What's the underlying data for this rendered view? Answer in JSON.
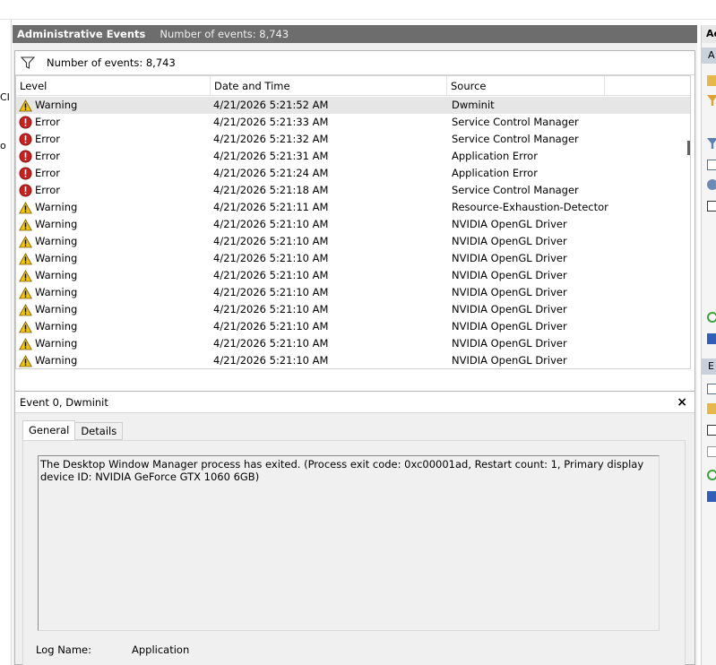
{
  "header": {
    "title": "Administrative Events",
    "count_label": "Number of events: 8,743"
  },
  "filter_bar": {
    "count_label": "Number of events: 8,743"
  },
  "columns": {
    "level": "Level",
    "datetime": "Date and Time",
    "source": "Source"
  },
  "events": [
    {
      "level": "Warning",
      "datetime": "4/21/2026 5:21:52 AM",
      "source": "Dwminit"
    },
    {
      "level": "Error",
      "datetime": "4/21/2026 5:21:33 AM",
      "source": "Service Control Manager"
    },
    {
      "level": "Error",
      "datetime": "4/21/2026 5:21:32 AM",
      "source": "Service Control Manager"
    },
    {
      "level": "Error",
      "datetime": "4/21/2026 5:21:31 AM",
      "source": "Application Error"
    },
    {
      "level": "Error",
      "datetime": "4/21/2026 5:21:24 AM",
      "source": "Application Error"
    },
    {
      "level": "Error",
      "datetime": "4/21/2026 5:21:18 AM",
      "source": "Service Control Manager"
    },
    {
      "level": "Warning",
      "datetime": "4/21/2026 5:21:11 AM",
      "source": "Resource-Exhaustion-Detector"
    },
    {
      "level": "Warning",
      "datetime": "4/21/2026 5:21:10 AM",
      "source": "NVIDIA OpenGL Driver"
    },
    {
      "level": "Warning",
      "datetime": "4/21/2026 5:21:10 AM",
      "source": "NVIDIA OpenGL Driver"
    },
    {
      "level": "Warning",
      "datetime": "4/21/2026 5:21:10 AM",
      "source": "NVIDIA OpenGL Driver"
    },
    {
      "level": "Warning",
      "datetime": "4/21/2026 5:21:10 AM",
      "source": "NVIDIA OpenGL Driver"
    },
    {
      "level": "Warning",
      "datetime": "4/21/2026 5:21:10 AM",
      "source": "NVIDIA OpenGL Driver"
    },
    {
      "level": "Warning",
      "datetime": "4/21/2026 5:21:10 AM",
      "source": "NVIDIA OpenGL Driver"
    },
    {
      "level": "Warning",
      "datetime": "4/21/2026 5:21:10 AM",
      "source": "NVIDIA OpenGL Driver"
    },
    {
      "level": "Warning",
      "datetime": "4/21/2026 5:21:10 AM",
      "source": "NVIDIA OpenGL Driver"
    },
    {
      "level": "Warning",
      "datetime": "4/21/2026 5:21:10 AM",
      "source": "NVIDIA OpenGL Driver"
    }
  ],
  "selected_index": 0,
  "detail": {
    "title": "Event 0, Dwminit",
    "close_glyph": "×",
    "tabs": [
      "General",
      "Details"
    ],
    "message": "The Desktop Window Manager process has exited. (Process exit code: 0xc00001ad, Restart count: 1, Primary display device ID: NVIDIA GeForce GTX 1060 6GB)",
    "log_name_label": "Log Name:",
    "log_name_value": "Application"
  },
  "left_gutter": [
    "CI",
    "o"
  ],
  "right_pane": {
    "header": "Ac",
    "sub1": "A",
    "sub2": "E"
  },
  "colors": {
    "header_bg": "#6d6d6d",
    "warning_yellow": "#f5c400",
    "error_red": "#c7201f",
    "selected_row": "#e6e6e6"
  },
  "icons": {
    "filter": "filter-icon",
    "warning": "warning-icon",
    "error": "error-icon",
    "close": "close-icon"
  }
}
